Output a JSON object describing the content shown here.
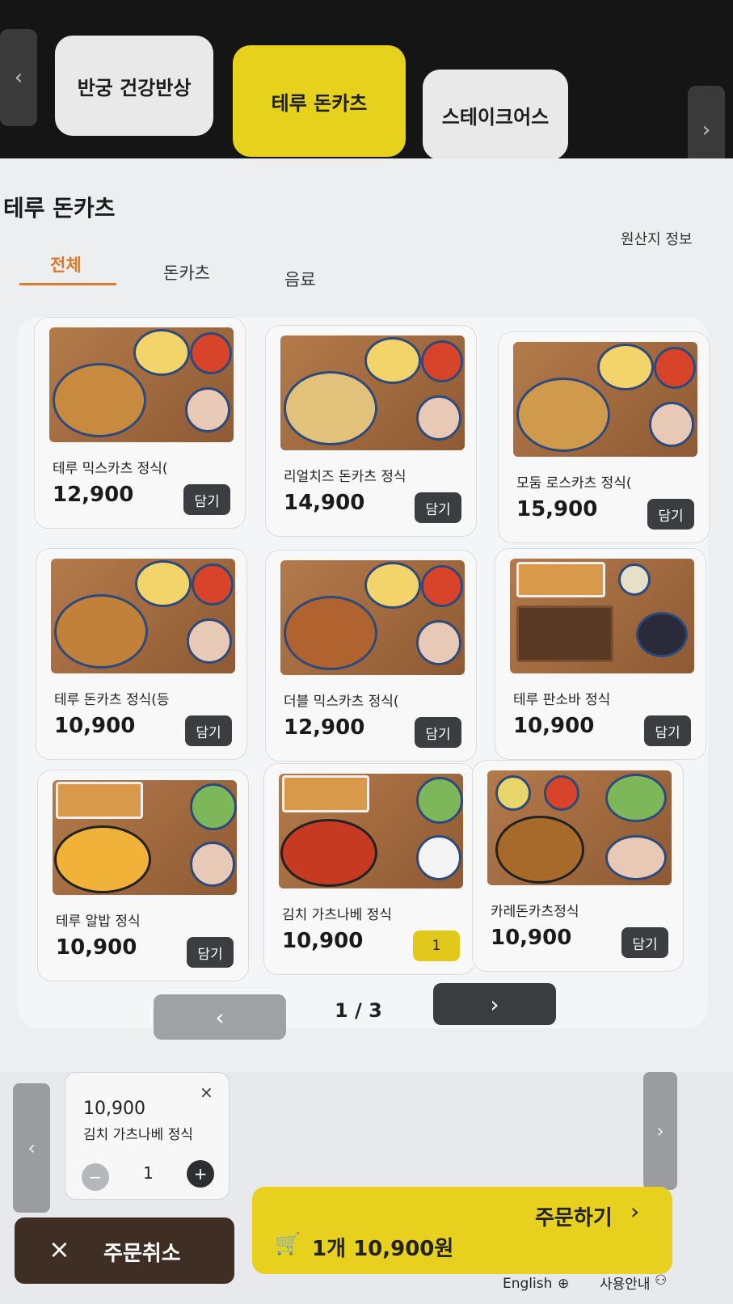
{
  "restaurants": [
    {
      "label": "반궁 건강반상",
      "active": false
    },
    {
      "label": "테루 돈카츠",
      "active": true
    },
    {
      "label": "스테이크어스",
      "active": false
    }
  ],
  "page_title": "테루 돈카츠",
  "origin_info": "원산지 정보",
  "categories": [
    "전체",
    "돈카츠",
    "음료"
  ],
  "menu": [
    {
      "name": "테루 믹스카츠 정식(",
      "price": "12,900",
      "button": "담기"
    },
    {
      "name": "리얼치즈 돈카츠 정식",
      "price": "14,900",
      "button": "담기"
    },
    {
      "name": "모둠 로스카츠 정식(",
      "price": "15,900",
      "button": "담기"
    },
    {
      "name": "테루 돈카츠 정식(등",
      "price": "10,900",
      "button": "담기"
    },
    {
      "name": "더블 믹스카츠 정식(",
      "price": "12,900",
      "button": "담기"
    },
    {
      "name": "테루 판소바 정식",
      "price": "10,900",
      "button": "담기"
    },
    {
      "name": "테루 알밥 정식",
      "price": "10,900",
      "button": "담기"
    },
    {
      "name": "김치 가츠나베 정식",
      "price": "10,900",
      "button": "1"
    },
    {
      "name": "카레돈카츠정식",
      "price": "10,900",
      "button": "담기"
    }
  ],
  "pager": {
    "text": "1 / 3",
    "prev": "‹",
    "next": "›"
  },
  "cart": {
    "items": [
      {
        "price": "10,900",
        "name": "김치 가츠나베 정식",
        "qty": "1",
        "remove": "×",
        "minus": "−",
        "plus": "+"
      }
    ]
  },
  "footer": {
    "cancel_label": "주문취소",
    "cancel_icon": "×",
    "order_summary": "1개 10,900원",
    "order_label": "주문하기",
    "order_chevron": "›",
    "language": "English",
    "help": "사용안내",
    "cart_icon": "🛒",
    "globe_icon": "⊕",
    "help_icon": "⚇"
  }
}
